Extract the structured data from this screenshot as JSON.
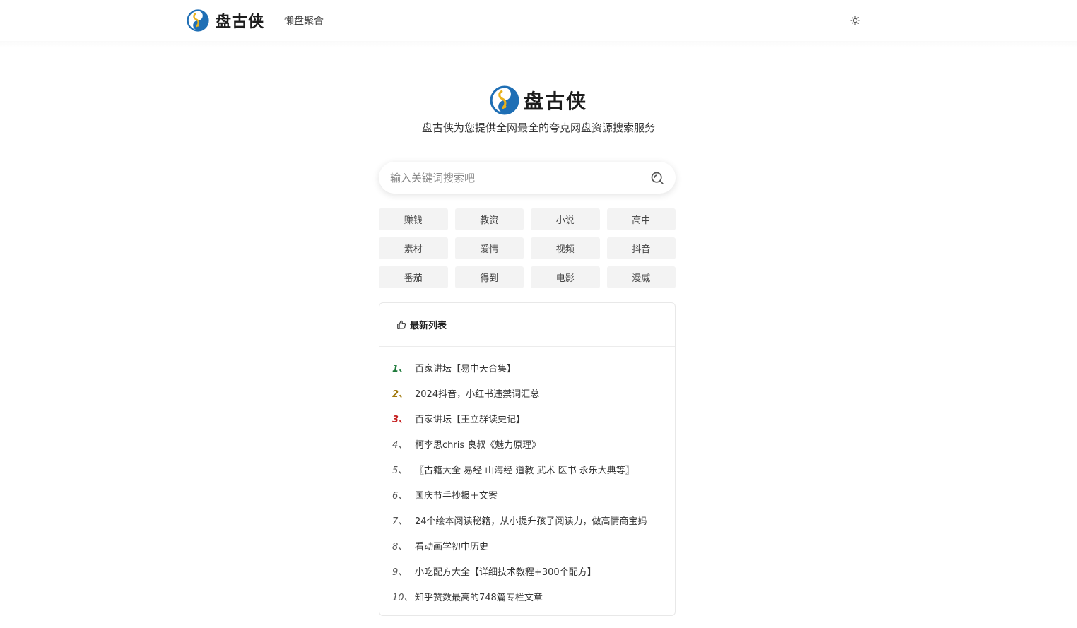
{
  "header": {
    "brand_name": "盘古侠",
    "nav_link": "懒盘聚合",
    "theme_icon": "sun-icon"
  },
  "hero": {
    "title": "盘古侠",
    "subtitle": "盘古侠为您提供全网最全的夸克网盘资源搜索服务"
  },
  "search": {
    "placeholder": "输入关键词搜索吧",
    "value": "",
    "icon": "search-icon"
  },
  "tags": [
    "赚钱",
    "教资",
    "小说",
    "高中",
    "素材",
    "爱情",
    "视频",
    "抖音",
    "番茄",
    "得到",
    "电影",
    "漫威"
  ],
  "latest": {
    "title": "最新列表",
    "icon": "thumbs-up-icon",
    "items": [
      {
        "rank": "1、",
        "title": "百家讲坛【易中天合集】"
      },
      {
        "rank": "2、",
        "title": "2024抖音，小红书违禁词汇总"
      },
      {
        "rank": "3、",
        "title": "百家讲坛【王立群读史记】"
      },
      {
        "rank": "4、",
        "title": "柯李思chris 良叔《魅力原理》"
      },
      {
        "rank": "5、",
        "title": "〖古籍大全 易经 山海经 道教 武术 医书 永乐大典等〗"
      },
      {
        "rank": "6、",
        "title": "国庆节手抄报＋文案"
      },
      {
        "rank": "7、",
        "title": "24个绘本阅读秘籍，从小提升孩子阅读力，做高情商宝妈"
      },
      {
        "rank": "8、",
        "title": "看动画学初中历史"
      },
      {
        "rank": "9、",
        "title": "小吃配方大全【详细技术教程+300个配方】"
      },
      {
        "rank": "10、",
        "title": "知乎赞数最高的748篇专栏文章"
      }
    ]
  },
  "colors": {
    "logo_blue": "#1f6fb5",
    "logo_gold": "#e9b21c",
    "rank1": "#1e7a3b",
    "rank2": "#a0770a",
    "rank3": "#c41c1c",
    "tag_bg": "#f3f3f3"
  }
}
